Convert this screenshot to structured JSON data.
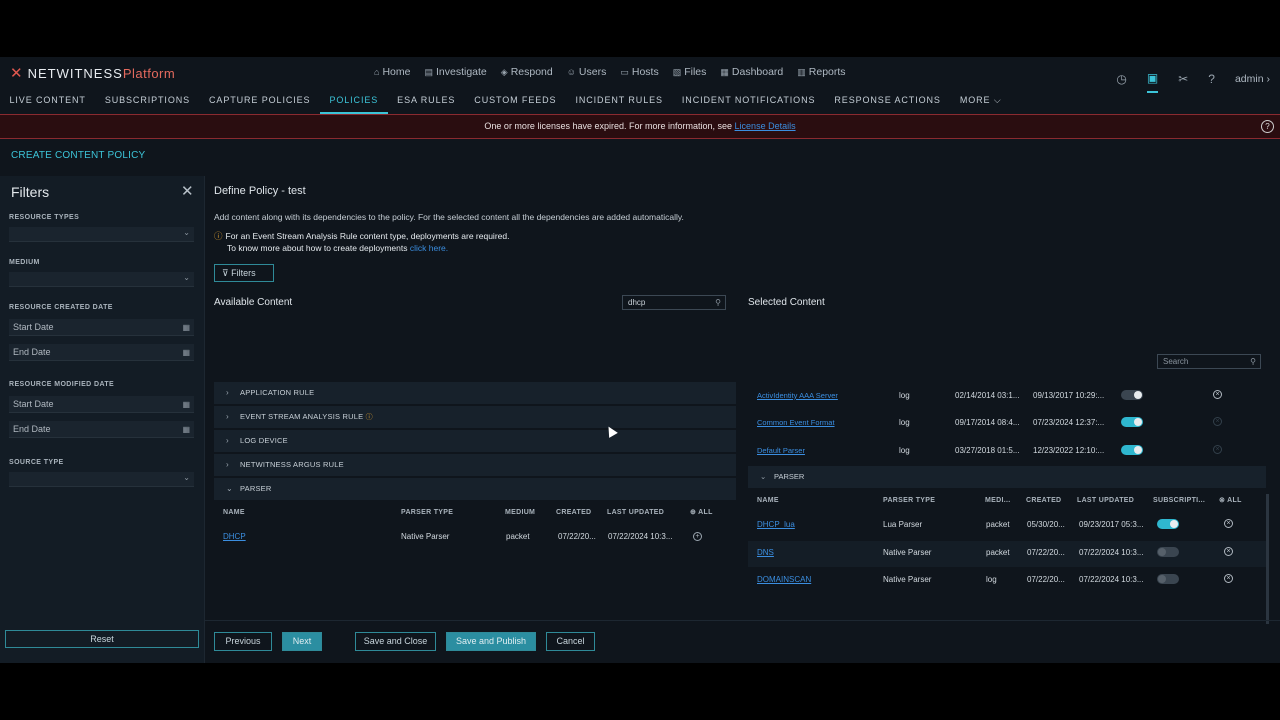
{
  "app": {
    "brand": "NETWITNESS",
    "brand_suffix": "Platform"
  },
  "mainnav": [
    {
      "icon": "home-icon",
      "glyph": "⌂",
      "label": "Home"
    },
    {
      "icon": "investigate-icon",
      "glyph": "▤",
      "label": "Investigate"
    },
    {
      "icon": "respond-icon",
      "glyph": "◈",
      "label": "Respond"
    },
    {
      "icon": "users-icon",
      "glyph": "☺",
      "label": "Users"
    },
    {
      "icon": "hosts-icon",
      "glyph": "▭",
      "label": "Hosts"
    },
    {
      "icon": "files-icon",
      "glyph": "▧",
      "label": "Files"
    },
    {
      "icon": "dashboard-icon",
      "glyph": "▦",
      "label": "Dashboard"
    },
    {
      "icon": "reports-icon",
      "glyph": "▥",
      "label": "Reports"
    }
  ],
  "user": "admin",
  "subnav": [
    "LIVE CONTENT",
    "SUBSCRIPTIONS",
    "CAPTURE POLICIES",
    "POLICIES",
    "ESA RULES",
    "CUSTOM FEEDS",
    "INCIDENT RULES",
    "INCIDENT NOTIFICATIONS",
    "RESPONSE ACTIONS",
    "MORE ⌵"
  ],
  "banner": {
    "text": "One or more licenses have expired. For more information, see ",
    "link": "License Details"
  },
  "page_title": "CREATE CONTENT POLICY",
  "filters": {
    "title": "Filters",
    "resource_types": "RESOURCE TYPES",
    "medium": "MEDIUM",
    "created_date": "RESOURCE CREATED DATE",
    "modified_date": "RESOURCE MODIFIED DATE",
    "source_type": "SOURCE TYPE",
    "start_date": "Start Date",
    "end_date": "End Date",
    "reset": "Reset"
  },
  "define": {
    "title": "Define Policy - test",
    "desc": "Add content along with its dependencies to the policy. For the selected content all the dependencies are added automatically.",
    "warn1": "For an Event Stream Analysis Rule content type, deployments are required.",
    "warn2": "To know more about how to create deployments ",
    "warn2_link": "click here.",
    "filters_btn": "Filters"
  },
  "available": {
    "title": "Available Content",
    "search_value": "dhcp",
    "categories": [
      "APPLICATION RULE",
      "EVENT STREAM ANALYSIS RULE",
      "LOG DEVICE",
      "NETWITNESS ARGUS RULE",
      "PARSER"
    ],
    "headers": {
      "name": "NAME",
      "parser_type": "PARSER TYPE",
      "medium": "MEDIUM",
      "created": "CREATED",
      "last_updated": "LAST UPDATED",
      "all": "ALL"
    },
    "rows": [
      {
        "name": "DHCP",
        "parser_type": "Native Parser",
        "medium": "packet",
        "created": "07/22/20...",
        "last_updated": "07/22/2024 10:3..."
      }
    ]
  },
  "selected": {
    "title": "Selected Content",
    "search_placeholder": "Search",
    "top_rows": [
      {
        "name": "ActivIdentity AAA Server",
        "medium": "log",
        "created": "02/14/2014 03:1...",
        "last_updated": "09/13/2017 10:29:...",
        "subscribed": false
      },
      {
        "name": "Common Event Format",
        "medium": "log",
        "created": "09/17/2014 08:4...",
        "last_updated": "07/23/2024 12:37:...",
        "subscribed": true
      },
      {
        "name": "Default Parser",
        "medium": "log",
        "created": "03/27/2018 01:5...",
        "last_updated": "12/23/2022 12:10:...",
        "subscribed": true
      }
    ],
    "parser_section": "PARSER",
    "headers": {
      "name": "NAME",
      "parser_type": "PARSER TYPE",
      "medium": "MEDI...",
      "created": "CREATED",
      "last_updated": "LAST UPDATED",
      "subscription": "SUBSCRIPTI...",
      "all": "ALL"
    },
    "parser_rows": [
      {
        "name": "DHCP_lua",
        "parser_type": "Lua Parser",
        "medium": "packet",
        "created": "05/30/20...",
        "last_updated": "09/23/2017 05:3...",
        "subscribed": true
      },
      {
        "name": "DNS",
        "parser_type": "Native Parser",
        "medium": "packet",
        "created": "07/22/20...",
        "last_updated": "07/22/2024 10:3...",
        "subscribed": false
      },
      {
        "name": "DOMAINSCAN",
        "parser_type": "Native Parser",
        "medium": "log",
        "created": "07/22/20...",
        "last_updated": "07/22/2024 10:3...",
        "subscribed": false
      }
    ]
  },
  "footer": {
    "previous": "Previous",
    "next": "Next",
    "save_close": "Save and Close",
    "save_publish": "Save and Publish",
    "cancel": "Cancel"
  },
  "colors": {
    "accent": "#2fb7cf",
    "link": "#3b8ee0",
    "brand": "#e0584f",
    "warning": "#e0a030"
  }
}
